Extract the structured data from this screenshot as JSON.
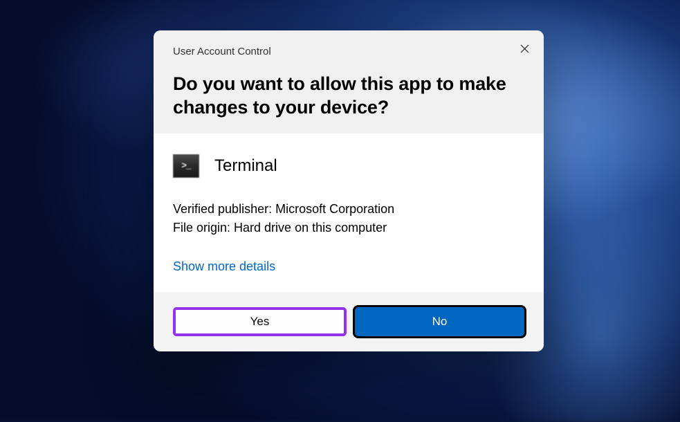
{
  "dialog": {
    "title_small": "User Account Control",
    "title_large": "Do you want to allow this app to make changes to your device?",
    "app_name": "Terminal",
    "publisher_line": "Verified publisher: Microsoft Corporation",
    "origin_line": "File origin: Hard drive on this computer",
    "details_link": "Show more details",
    "yes_label": "Yes",
    "no_label": "No"
  }
}
